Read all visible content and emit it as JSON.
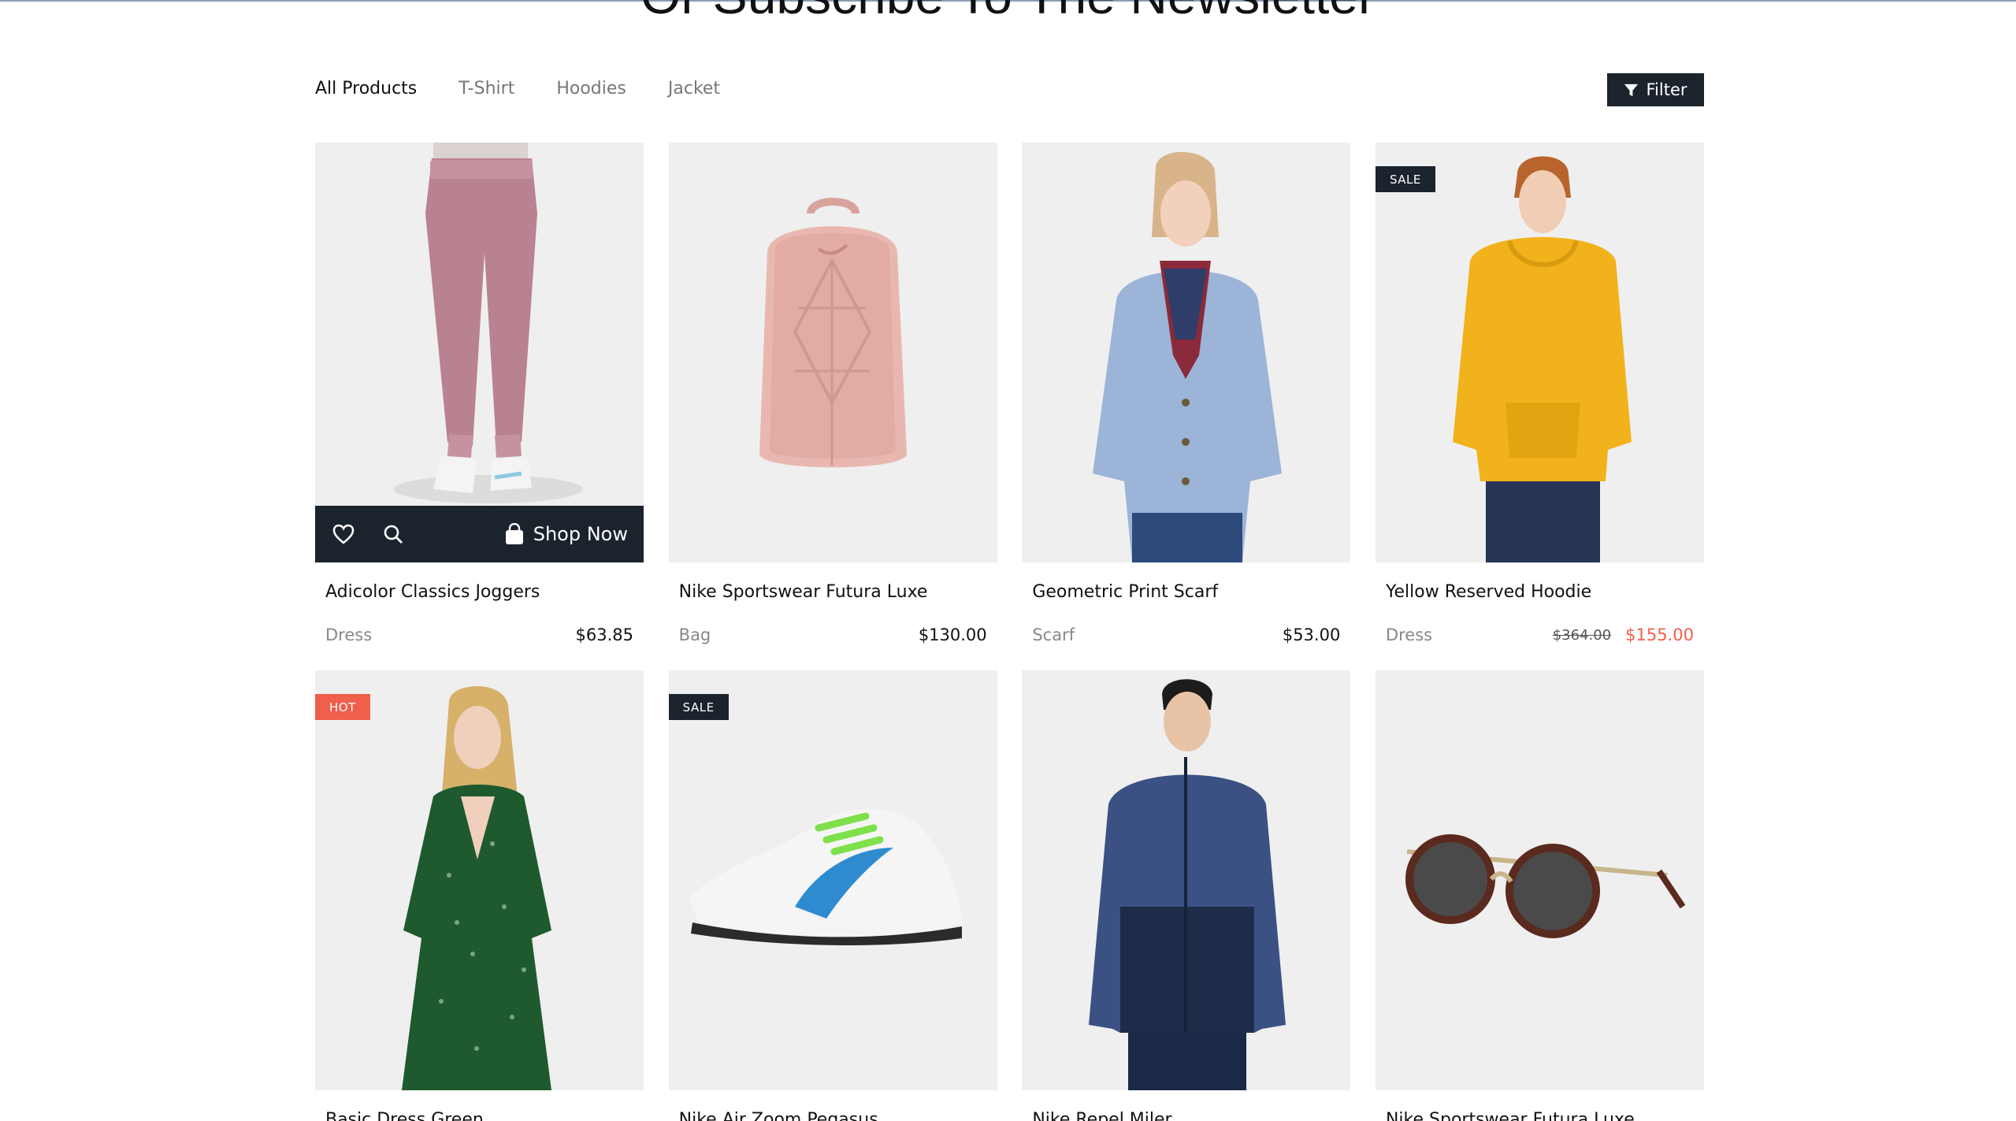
{
  "page": {
    "heading": "Or Subscribe To The Newsletter"
  },
  "tabs": [
    {
      "label": "All Products",
      "active": true
    },
    {
      "label": "T-Shirt",
      "active": false
    },
    {
      "label": "Hoodies",
      "active": false
    },
    {
      "label": "Jacket",
      "active": false
    }
  ],
  "filter": {
    "label": "Filter",
    "icon": "funnel-icon"
  },
  "hover_actions": {
    "wishlist_icon": "heart-icon",
    "quickview_icon": "search-icon",
    "shop_icon": "shopping-bag-icon",
    "shop_label": "Shop Now"
  },
  "colors": {
    "dark": "#1b232d",
    "accent": "#f05e4c",
    "image_bg": "#efefef"
  },
  "products": [
    {
      "title": "Adicolor Classics Joggers",
      "category": "Dress",
      "price": "$63.85",
      "badge": "",
      "image": "pink-joggers"
    },
    {
      "title": "Nike Sportswear Futura Luxe",
      "category": "Bag",
      "price": "$130.00",
      "badge": "",
      "image": "pink-backpack"
    },
    {
      "title": "Geometric Print Scarf",
      "category": "Scarf",
      "price": "$53.00",
      "badge": "",
      "image": "blue-cardigan-scarf"
    },
    {
      "title": "Yellow Reserved Hoodie",
      "category": "Dress",
      "old_price": "$364.00",
      "price": "$155.00",
      "badge": "SALE",
      "image": "yellow-hoodie"
    },
    {
      "title": "Basic Dress Green",
      "category": "",
      "price": "",
      "badge": "HOT",
      "image": "green-dress"
    },
    {
      "title": "Nike Air Zoom Pegasus",
      "category": "",
      "price": "",
      "badge": "SALE",
      "image": "white-sneaker"
    },
    {
      "title": "Nike Repel Miler",
      "category": "",
      "price": "",
      "badge": "",
      "image": "navy-jacket"
    },
    {
      "title": "Nike Sportswear Futura Luxe",
      "category": "",
      "price": "",
      "badge": "",
      "image": "sunglasses"
    }
  ]
}
